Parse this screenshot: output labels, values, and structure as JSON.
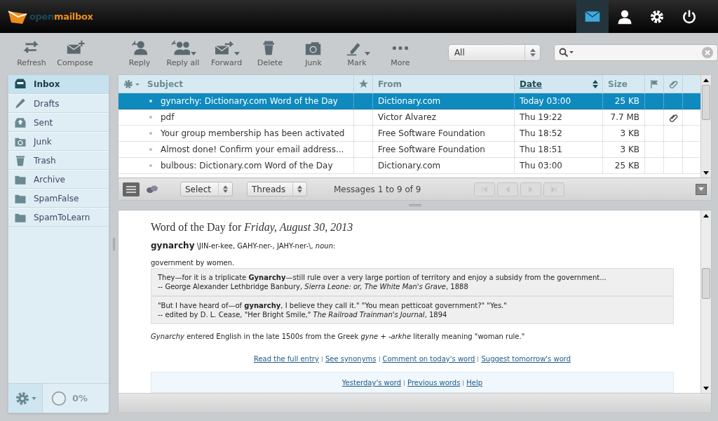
{
  "header": {
    "logo": {
      "first": "open",
      "second": "mailbox"
    },
    "nav": [
      {
        "kind": "mail",
        "selected": true
      },
      {
        "kind": "contacts",
        "selected": false
      },
      {
        "kind": "settings",
        "selected": false
      },
      {
        "kind": "logout",
        "selected": false
      }
    ]
  },
  "toolbar": {
    "buttons": [
      {
        "kind": "refresh",
        "label": "Refresh",
        "menu": false
      },
      {
        "kind": "compose",
        "label": "Compose",
        "menu": false
      },
      {
        "kind": "reply",
        "label": "Reply",
        "menu": false
      },
      {
        "kind": "replyall",
        "label": "Reply all",
        "menu": true
      },
      {
        "kind": "forward",
        "label": "Forward",
        "menu": true
      },
      {
        "kind": "delete",
        "label": "Delete",
        "menu": false
      },
      {
        "kind": "junk",
        "label": "Junk",
        "menu": false
      },
      {
        "kind": "mark",
        "label": "Mark",
        "menu": true
      },
      {
        "kind": "more",
        "label": "More",
        "menu": false
      }
    ],
    "filter": "All"
  },
  "sidebar": {
    "folders": [
      {
        "kind": "inbox",
        "label": "Inbox",
        "selected": true
      },
      {
        "kind": "drafts",
        "label": "Drafts",
        "selected": false
      },
      {
        "kind": "sent",
        "label": "Sent",
        "selected": false
      },
      {
        "kind": "junk",
        "label": "Junk",
        "selected": false
      },
      {
        "kind": "trash",
        "label": "Trash",
        "selected": false
      },
      {
        "kind": "folder",
        "label": "Archive",
        "selected": false
      },
      {
        "kind": "folder",
        "label": "SpamFalse",
        "selected": false
      },
      {
        "kind": "folder",
        "label": "SpamToLearn",
        "selected": false
      }
    ],
    "quota": {
      "text": "0%"
    }
  },
  "message_list": {
    "columns": [
      {
        "kind": "subject",
        "label": "Subject",
        "sorted": false
      },
      {
        "kind": "star"
      },
      {
        "kind": "from",
        "label": "From",
        "sorted": false
      },
      {
        "kind": "date",
        "label": "Date",
        "sorted": true
      },
      {
        "kind": "size",
        "label": "Size",
        "sorted": false
      },
      {
        "kind": "flag"
      },
      {
        "kind": "attachment"
      }
    ],
    "rows": [
      {
        "subject": "gynarchy: Dictionary.com Word of the Day",
        "from": "Dictionary.com",
        "date": "Today 03:00",
        "size": "25 KB",
        "attachment": false,
        "selected": true
      },
      {
        "subject": "pdf",
        "from": "Victor Alvarez",
        "date": "Thu 19:22",
        "size": "7.7 MB",
        "attachment": true,
        "selected": false
      },
      {
        "subject": "Your group membership has been activated",
        "from": "Free Software Foundation",
        "date": "Thu 18:52",
        "size": "3 KB",
        "attachment": false,
        "selected": false
      },
      {
        "subject": "Almost done! Confirm your email address...",
        "from": "Free Software Foundation",
        "date": "Thu 18:51",
        "size": "3 KB",
        "attachment": false,
        "selected": false
      },
      {
        "subject": "bulbous: Dictionary.com Word of the Day",
        "from": "Dictionary.com",
        "date": "Thu 03:00",
        "size": "25 KB",
        "attachment": false,
        "selected": false
      }
    ],
    "footer": {
      "select": "Select",
      "threads": "Threads",
      "count": "Messages 1 to 9 of 9"
    }
  },
  "preview": {
    "heading": "Word of the Day for *Friday, August 30, 2013*",
    "pronunciation": "**gynarchy** \\JIN-er-kee, GAHY-ner-, JAHY-ner-\\, *noun*:",
    "definition": "government by women.",
    "quotes": [
      {
        "text": "They—for it is a triplicate **Gynarchy**—still rule over a very large portion of territory and enjoy a subsidy from the government...",
        "source": "-- George Alexander Lethbridge Banbury, *Sierra Leone: or, The White Man's Grave*, 1888"
      },
      {
        "text": "\"But I have heard of—of **gynarchy**, I believe they call it.\" \"You mean petticoat government?\" \"Yes.\"",
        "source": "-- edited by D. L. Cease, \"Her Bright Smile,\" *The Railroad Trainman's Journal*, 1894"
      }
    ],
    "etymology": "*Gynarchy* entered English in the late 1500s from the Greek *gyne* + *-arkhe* literally meaning \"woman rule.\"",
    "links": [
      "Read the full entry",
      "See synonyms",
      "Comment on today's word",
      "Suggest tomorrow's word"
    ],
    "footer_links": [
      "Yesterday's word",
      "Previous words",
      "Help"
    ]
  }
}
